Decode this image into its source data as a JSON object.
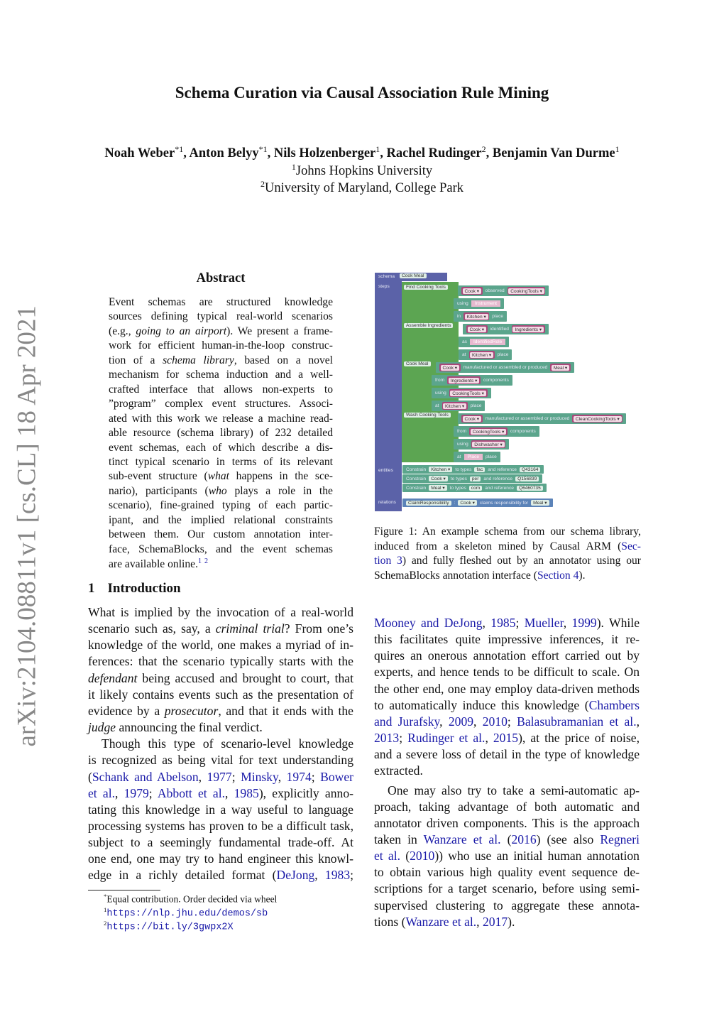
{
  "title": "Schema Curation via Causal Association Rule Mining",
  "authors": [
    {
      "name": "Noah Weber",
      "sup": "*1"
    },
    {
      "name": "Anton Belyy",
      "sup": "*1"
    },
    {
      "name": "Nils Holzenberger",
      "sup": "1"
    },
    {
      "name": "Rachel Rudinger",
      "sup": "2"
    },
    {
      "name": "Benjamin Van Durme",
      "sup": "1"
    }
  ],
  "affiliations": [
    {
      "sup": "1",
      "name": "Johns Hopkins University"
    },
    {
      "sup": "2",
      "name": "University of Maryland, College Park"
    }
  ],
  "arxiv_stamp": "arXiv:2104.08811v1  [cs.CL]  18 Apr 2021",
  "abstract": {
    "heading": "Abstract",
    "lines": [
      [
        "Event schemas are structured knowledge"
      ],
      [
        "sources defining typical real-world scenarios"
      ],
      [
        "(e.g., ",
        [
          "i",
          "going to an airport"
        ],
        "). We present a frame-"
      ],
      [
        "work for efficient human-in-the-loop construc-"
      ],
      [
        "tion of a ",
        [
          "i",
          "schema library"
        ],
        ", based on a novel"
      ],
      [
        "mechanism for schema induction and a well-"
      ],
      [
        "crafted interface that allows non-experts to"
      ],
      [
        "”program” complex event structures. Associ-"
      ],
      [
        "ated with this work we release a machine read-"
      ],
      [
        "able resource (schema library) of 232 detailed"
      ],
      [
        "event schemas, each of which describe a dis-"
      ],
      [
        "tinct typical scenario in terms of its relevant"
      ],
      [
        "sub-event structure (",
        [
          "i",
          "what"
        ],
        " happens in the sce-"
      ],
      [
        "nario), participants (",
        [
          "i",
          "who"
        ],
        " plays a role in the"
      ],
      [
        "scenario), fine-grained typing of each partic-"
      ],
      [
        "ipant, and the implied relational constraints"
      ],
      [
        "between them. Our custom annotation inter-"
      ],
      [
        "face, SchemaBlocks, and the event schemas"
      ],
      [
        "are available online.",
        [
          "s",
          "1"
        ],
        " ",
        [
          "s",
          "2"
        ]
      ]
    ]
  },
  "intro": {
    "number": "1",
    "heading": "Introduction",
    "paragraphs": [
      [
        [
          "What is implied by the invocation of a real-world"
        ],
        [
          "scenario such as, say, a ",
          [
            "i",
            "criminal trial"
          ],
          "? From one’s"
        ],
        [
          "knowledge of the world, one makes a myriad of in-"
        ],
        [
          "ferences: that the scenario typically starts with the"
        ],
        [
          [
            "i",
            "defendant"
          ],
          " being accused and brought to court, that"
        ],
        [
          "it likely contains events such as the presentation of"
        ],
        [
          "evidence by a ",
          [
            "i",
            "prosecutor"
          ],
          ", and that it ends with the"
        ],
        [
          [
            "i",
            "judge"
          ],
          " announcing the final verdict."
        ]
      ],
      [
        [
          "Though this type of scenario-level knowledge"
        ],
        [
          "is recognized as being vital for text understanding"
        ],
        [
          "(",
          [
            "l",
            "Schank and Abelson"
          ],
          ", ",
          [
            "l",
            "1977"
          ],
          "; ",
          [
            "l",
            "Minsky"
          ],
          ", ",
          [
            "l",
            "1974"
          ],
          "; ",
          [
            "l",
            "Bower"
          ]
        ],
        [
          [
            "l",
            "et al."
          ],
          ", ",
          [
            "l",
            "1979"
          ],
          "; ",
          [
            "l",
            "Abbott et al."
          ],
          ", ",
          [
            "l",
            "1985"
          ],
          "), explicitly anno-"
        ],
        [
          "tating this knowledge in a way useful to language"
        ],
        [
          "processing systems has proven to be a difficult task,"
        ],
        [
          "subject to a seemingly fundamental trade-off. At"
        ],
        [
          "one end, one may try to hand engineer this knowl-"
        ],
        [
          "edge in a richly detailed format (",
          [
            "l",
            "DeJong"
          ],
          ", ",
          [
            "l",
            "1983"
          ],
          ";"
        ]
      ]
    ],
    "right_paragraphs": [
      [
        [
          [
            "l",
            "Mooney and DeJong"
          ],
          ", ",
          [
            "l",
            "1985"
          ],
          "; ",
          [
            "l",
            "Mueller"
          ],
          ", ",
          [
            "l",
            "1999"
          ],
          "). While"
        ],
        [
          "this facilitates quite impressive inferences, it re-"
        ],
        [
          "quires an onerous annotation effort carried out by"
        ],
        [
          "experts, and hence tends to be difficult to scale. On"
        ],
        [
          "the other end, one may employ data-driven methods"
        ],
        [
          "to automatically induce this knowledge (",
          [
            "l",
            "Chambers"
          ]
        ],
        [
          [
            "l",
            "and Jurafsky"
          ],
          ", ",
          [
            "l",
            "2009"
          ],
          ", ",
          [
            "l",
            "2010"
          ],
          "; ",
          [
            "l",
            "Balasubramanian et al."
          ],
          ","
        ],
        [
          [
            "l",
            "2013"
          ],
          "; ",
          [
            "l",
            "Rudinger et al."
          ],
          ", ",
          [
            "l",
            "2015"
          ],
          "), at the price of noise,"
        ],
        [
          "and a severe loss of detail in the type of knowledge"
        ],
        [
          "extracted."
        ]
      ],
      [
        [
          "One may also try to take a semi-automatic ap-"
        ],
        [
          "proach, taking advantage of both automatic and"
        ],
        [
          "annotator driven components. This is the approach"
        ],
        [
          "taken in ",
          [
            "l",
            "Wanzare et al."
          ],
          " (",
          [
            "l",
            "2016"
          ],
          ") (see also ",
          [
            "l",
            "Regneri"
          ]
        ],
        [
          [
            "l",
            "et al."
          ],
          " (",
          [
            "l",
            "2010"
          ],
          ")) who use an initial human annotation"
        ],
        [
          "to obtain various high quality event sequence de-"
        ],
        [
          "scriptions for a target scenario, before using semi-"
        ],
        [
          "supervised clustering to aggregate these annota-"
        ],
        [
          "tions (",
          [
            "l",
            "Wanzare et al."
          ],
          ", ",
          [
            "l",
            "2017"
          ],
          ")."
        ]
      ]
    ]
  },
  "footnotes": [
    {
      "mark": "*",
      "text": "Equal contribution. Order decided via wheel"
    },
    {
      "mark": "1",
      "url": "https://nlp.jhu.edu/demos/sb"
    },
    {
      "mark": "2",
      "url": "https://bit.ly/3gwpx2X"
    }
  ],
  "figure": {
    "caption": [
      [
        "Figure 1: An example schema from our schema library,"
      ],
      [
        "induced from a skeleton mined by Causal ARM (",
        [
          "l",
          "Sec-"
        ]
      ],
      [
        [
          "l",
          "tion 3"
        ],
        ") and fully fleshed out by an annotator using our"
      ],
      [
        "SchemaBlocks annotation interface (",
        [
          "l",
          "Section 4"
        ],
        ")."
      ]
    ],
    "schema_label": "schema",
    "schema_name": "Cook Meal",
    "steps_label": "steps",
    "entities_label": "entities",
    "relations_label": "relations",
    "steps": [
      {
        "name": "Find Cooking Tools",
        "rows": [
          [
            [
              "d",
              "Cook"
            ],
            "observed",
            [
              "d",
              "CookingTools"
            ]
          ],
          [
            "using",
            [
              "p",
              "Instrument"
            ]
          ],
          [
            "in",
            [
              "d",
              "Kitchen"
            ],
            "place"
          ]
        ]
      },
      {
        "name": "Assemble Ingredients",
        "rows": [
          [
            [
              "d",
              "Cook"
            ],
            "identified",
            [
              "d",
              "Ingredients"
            ]
          ],
          [
            "as",
            [
              "p",
              "IdentifiedRole"
            ]
          ],
          [
            "at",
            [
              "d",
              "Kitchen"
            ],
            "place"
          ]
        ]
      },
      {
        "name": "Cook Meal",
        "rows": [
          [
            [
              "d",
              "Cook"
            ],
            "manufactured or assembled or produced",
            [
              "d",
              "Meal"
            ]
          ],
          [
            "from",
            [
              "d",
              "Ingredients"
            ],
            "components"
          ],
          [
            "using",
            [
              "d",
              "CookingTools"
            ]
          ],
          [
            "at",
            [
              "d",
              "Kitchen"
            ],
            "place"
          ]
        ]
      },
      {
        "name": "Wash Cooking Tools",
        "rows": [
          [
            [
              "d",
              "Cook"
            ],
            "manufactured or assembled or produced",
            [
              "d",
              "CleanCookingTools"
            ]
          ],
          [
            "from",
            [
              "d",
              "CookingTools"
            ],
            "components"
          ],
          [
            "using",
            [
              "d",
              "Dishwasher"
            ]
          ],
          [
            "at",
            [
              "p",
              "Place"
            ],
            "place"
          ]
        ]
      }
    ],
    "entities": [
      [
        "Constrain",
        [
          "t",
          "Kitchen ▾"
        ],
        "to types",
        [
          "t",
          "fac"
        ],
        "and reference",
        [
          "t",
          "Q43164"
        ]
      ],
      [
        "Constrain",
        [
          "t",
          "Cook ▾"
        ],
        "to types",
        [
          "t",
          "per"
        ],
        "and reference",
        [
          "t",
          "Q156839"
        ]
      ],
      [
        "Constrain",
        [
          "t",
          "Meal ▾"
        ],
        "to types",
        [
          "t",
          "com"
        ],
        "and reference",
        [
          "t",
          "Q6460735"
        ]
      ]
    ],
    "relations": [
      [
        [
          "t",
          "ClaimResponsibility"
        ],
        ":",
        [
          "t",
          "Cook ▾"
        ],
        "claims responsibility for",
        [
          "t",
          "Meal ▾"
        ]
      ]
    ],
    "colors": {
      "schema": "#5b62a8",
      "step": "#5ca552",
      "row": "#5ba58c",
      "dropdown": "#a9487a",
      "relation": "#5b83b8",
      "link": "#1a1aa8"
    }
  }
}
